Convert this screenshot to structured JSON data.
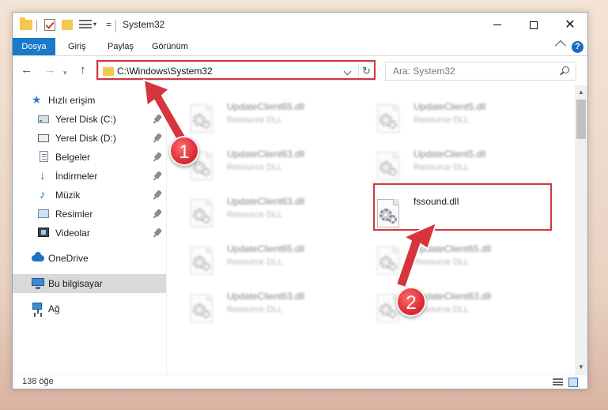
{
  "window": {
    "title": "System32"
  },
  "ribbon": {
    "tabs": [
      "Dosya",
      "Giriş",
      "Paylaş",
      "Görünüm"
    ]
  },
  "navbar": {
    "address": "C:\\Windows\\System32",
    "search_placeholder": "Ara: System32"
  },
  "sidebar": {
    "items": [
      {
        "label": "Hızlı erişim",
        "icon": "quick-access-star-icon"
      },
      {
        "label": "Yerel Disk (C:)",
        "icon": "local-disk-icon"
      },
      {
        "label": "Yerel Disk (D:)",
        "icon": "local-disk-icon"
      },
      {
        "label": "Belgeler",
        "icon": "documents-icon"
      },
      {
        "label": "İndirmeler",
        "icon": "downloads-icon"
      },
      {
        "label": "Müzik",
        "icon": "music-icon"
      },
      {
        "label": "Resimler",
        "icon": "pictures-icon"
      },
      {
        "label": "Videolar",
        "icon": "videos-icon"
      },
      {
        "label": "OneDrive",
        "icon": "onedrive-cloud-icon"
      },
      {
        "label": "Bu bilgisayar",
        "icon": "this-pc-icon"
      },
      {
        "label": "Ağ",
        "icon": "network-icon"
      }
    ],
    "selected": "Bu bilgisayar"
  },
  "files": [
    {
      "name": "UpdateClient65.dll",
      "type": "Resource DLL"
    },
    {
      "name": "UpdateClient5.dll",
      "type": "Resource DLL"
    },
    {
      "name": "UpdateClient63.dll",
      "type": "Resource DLL"
    },
    {
      "name": "UpdateClient5.dll",
      "type": "Resource DLL"
    },
    {
      "name": "UpdateClient63.dll",
      "type": "Resource DLL"
    },
    {
      "name": "fssound.dll",
      "type": ""
    },
    {
      "name": "UpdateClient65.dll",
      "type": "Resource DLL"
    },
    {
      "name": "UpdateClient65.dll",
      "type": "Resource DLL"
    },
    {
      "name": "UpdateClient63.dll",
      "type": "Resource DLL"
    },
    {
      "name": "UpdateClient63.dll",
      "type": "Resource DLL"
    }
  ],
  "status": {
    "item_count": "138 öğe"
  },
  "annotations": {
    "badge1": "1",
    "badge2": "2",
    "color": "#d6353d"
  },
  "colors": {
    "accent": "#1979ca",
    "selection": "#d9d9d9"
  }
}
